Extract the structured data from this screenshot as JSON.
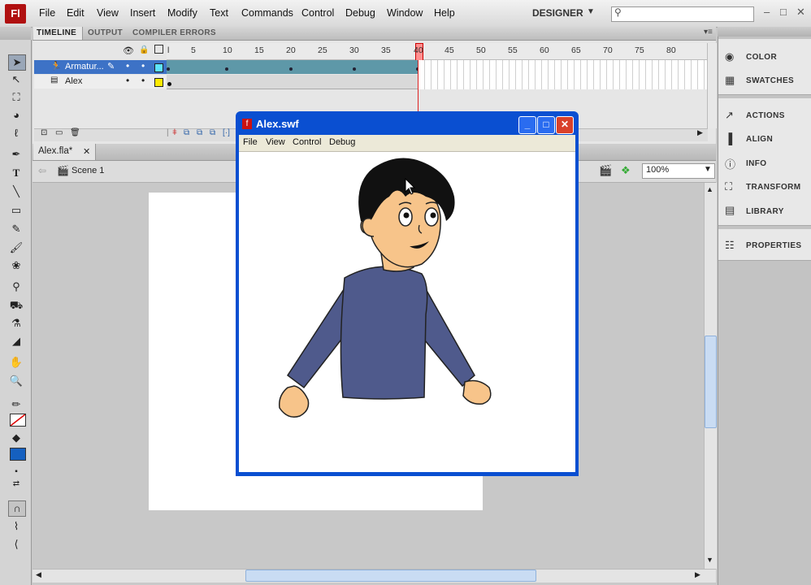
{
  "app": {
    "logo": "Fl"
  },
  "menu": [
    "File",
    "Edit",
    "View",
    "Insert",
    "Modify",
    "Text",
    "Commands",
    "Control",
    "Debug",
    "Window",
    "Help"
  ],
  "workspace": {
    "label": "DESIGNER"
  },
  "panel_tabs": [
    "TIMELINE",
    "OUTPUT",
    "COMPILER ERRORS"
  ],
  "timeline": {
    "frame_numbers": [
      "5",
      "10",
      "15",
      "20",
      "25",
      "30",
      "35",
      "40",
      "45",
      "50",
      "55",
      "60",
      "65",
      "70",
      "75",
      "80"
    ],
    "current_frame": 40,
    "layers": [
      {
        "name": "Armatur...",
        "selected": true
      },
      {
        "name": "Alex",
        "selected": false
      }
    ],
    "colors": {
      "armature_layer": "#3d72c6",
      "armature_frames": "#5e98a8"
    }
  },
  "document": {
    "tab": "Alex.fla*",
    "scene": "Scene 1",
    "zoom": "100%"
  },
  "right_panels": {
    "group1": [
      "COLOR",
      "SWATCHES"
    ],
    "group2": [
      "ACTIONS",
      "ALIGN",
      "INFO",
      "TRANSFORM",
      "LIBRARY"
    ],
    "group3": [
      "PROPERTIES"
    ]
  },
  "swf_window": {
    "title": "Alex.swf",
    "menu": [
      "File",
      "View",
      "Control",
      "Debug"
    ],
    "colors": {
      "titlebar": "#0a4fd1",
      "sweater": "#4f5a8c",
      "skin": "#f7c48a",
      "hair": "#111111"
    }
  }
}
